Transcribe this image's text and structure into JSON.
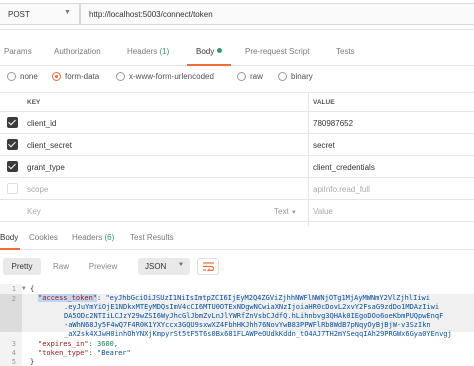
{
  "request": {
    "method": "POST",
    "url": "http://localhost:5003/connect/token"
  },
  "request_tabs": [
    {
      "label": "Params"
    },
    {
      "label": "Authorization"
    },
    {
      "label": "Headers",
      "count": "(1)"
    },
    {
      "label": "Body"
    },
    {
      "label": "Pre-request Script"
    },
    {
      "label": "Tests"
    }
  ],
  "body_types": [
    {
      "label": "none"
    },
    {
      "label": "form-data"
    },
    {
      "label": "x-www-form-urlencoded"
    },
    {
      "label": "raw"
    },
    {
      "label": "binary"
    }
  ],
  "body_type_selected": "form-data",
  "params_table": {
    "headers": [
      "KEY",
      "VALUE"
    ],
    "rows": [
      {
        "key": "client_id",
        "value": "780987652",
        "enabled": true
      },
      {
        "key": "client_secret",
        "value": "secret",
        "enabled": true
      },
      {
        "key": "grant_type",
        "value": "client_credentials",
        "enabled": true
      },
      {
        "key": "scope",
        "value": "apiInfo.read_full",
        "enabled": false
      }
    ],
    "new_row": {
      "key_placeholder": "Key",
      "type_label": "Text",
      "value_placeholder": "Value"
    }
  },
  "response_tabs": [
    {
      "label": "Body"
    },
    {
      "label": "Cookies"
    },
    {
      "label": "Headers",
      "count": "(6)"
    },
    {
      "label": "Test Results"
    }
  ],
  "response_toolbar": {
    "pretty": "Pretty",
    "raw": "Raw",
    "preview": "Preview",
    "format": "JSON"
  },
  "response_code": {
    "line_numbers": [
      "1",
      "2",
      "",
      "",
      "",
      "",
      "3",
      "4",
      "5"
    ],
    "open_brace": "{",
    "access_token_key": "\"access_token\"",
    "access_token_lines": [
      "\"eyJhbGciOiJSUzI1NiIsImtpZCI6IjEyM2Q4ZGViZjhhNWFlNWNjOTg1MjAyMWNmY2VlZjhlIiwi",
      ".eyJuYmYiOjE1NDkxMTEyMDQsImV4cCI6MTU0OTExNDgwNCwiaXNzIjoiaHR0cDovL2xvY2FsaG9zdDo1MDAzIiwi",
      "DA5ODc2NTIiLCJzY29wZSI6WyJhcGlJbmZvLnJlYWRfZnVsbCJdfQ.hLihnbvg3QHAk0IEgoDOo6oeKbmPUQpwEnqF",
      "-aWhN68Jy5F4wQ7F4R0K1YXYccx3GQU9sxwXZ4FbhHKJhh76NovYwB83PPWFlRb8WdB7pNqyOyBjBjW-v3SzIkn",
      "_aX2sk4XJwH0inhOhYNXjKmpyrSt5tF5T6s0Bx681FLAWPeOUdkKddn_tO4AJ7TH2mYSeqqIAh29PRGWx6Gya0YEnvgj"
    ],
    "expires_key": "\"expires_in\"",
    "expires_value": "3600",
    "token_type_key": "\"token_type\"",
    "token_type_value": "\"Bearer\"",
    "close_brace": "}"
  },
  "colors": {
    "accent": "#f26b3a",
    "count": "#2e9f6b",
    "json_key": "#a31515",
    "json_string": "#0451a5",
    "json_number": "#098658"
  }
}
